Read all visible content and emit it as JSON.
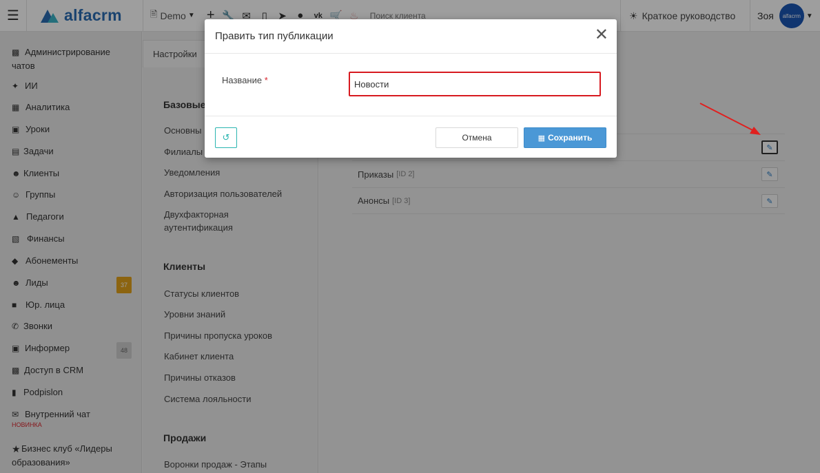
{
  "topbar": {
    "logo": "alfacrm",
    "branch": "Demo",
    "search_placeholder": "Поиск клиента",
    "guide_label": "Краткое руководство",
    "user_name": "Зоя",
    "avatar_text": "alfacrm"
  },
  "sidebar": {
    "items": [
      {
        "label": "Администрирование чатов",
        "icon": "chat-admin-icon"
      },
      {
        "label": "ИИ",
        "icon": "sparkle-icon"
      },
      {
        "label": "Аналитика",
        "icon": "map-icon"
      },
      {
        "label": "Уроки",
        "icon": "calendar-icon"
      },
      {
        "label": "Задачи",
        "icon": "clipboard-icon"
      },
      {
        "label": "Клиенты",
        "icon": "user-icon"
      },
      {
        "label": "Группы",
        "icon": "users-icon"
      },
      {
        "label": "Педагоги",
        "icon": "graduation-cap-icon"
      },
      {
        "label": "Финансы",
        "icon": "money-icon"
      },
      {
        "label": "Абонементы",
        "icon": "tag-icon"
      },
      {
        "label": "Лиды",
        "icon": "user-plus-icon",
        "badge": "37"
      },
      {
        "label": "Юр. лица",
        "icon": "briefcase-icon"
      },
      {
        "label": "Звонки",
        "icon": "phone-icon"
      },
      {
        "label": "Информер",
        "icon": "inbox-icon",
        "badge": "48"
      },
      {
        "label": "Доступ в CRM",
        "icon": "lock-icon"
      },
      {
        "label": "Podpislon",
        "icon": "document-icon"
      },
      {
        "label": "Внутренний чат",
        "icon": "mail-icon",
        "new": "НОВИНКА"
      },
      {
        "label": "Бизнес клуб «Лидеры образования»",
        "icon": "star-icon"
      }
    ]
  },
  "settings": {
    "tab_label": "Настройки",
    "sections": [
      {
        "title": "Базовые",
        "items": [
          "Основны",
          "Филиалы",
          "Уведомления",
          "Авторизация пользователей",
          "Двухфакторная аутентификация"
        ]
      },
      {
        "title": "Клиенты",
        "items": [
          "Статусы клиентов",
          "Уровни знаний",
          "Причины пропуска уроков",
          "Кабинет клиента",
          "Причины отказов",
          "Система лояльности"
        ]
      },
      {
        "title": "Продажи",
        "items": [
          "Воронки продаж - Этапы"
        ]
      }
    ]
  },
  "publication_types": [
    {
      "name": "",
      "id": ""
    },
    {
      "name": "Приказы",
      "id": "[ID 2]"
    },
    {
      "name": "Анонсы",
      "id": "[ID 3]"
    }
  ],
  "modal": {
    "title": "Править тип публикации",
    "field_label": "Название",
    "required_mark": "*",
    "field_value": "Новости",
    "cancel_label": "Отмена",
    "save_label": "Сохранить"
  },
  "colors": {
    "accent_blue": "#4b98d6",
    "highlight_red": "#d7191f",
    "badge_orange": "#e3a21a",
    "teal": "#2ab5b0"
  }
}
